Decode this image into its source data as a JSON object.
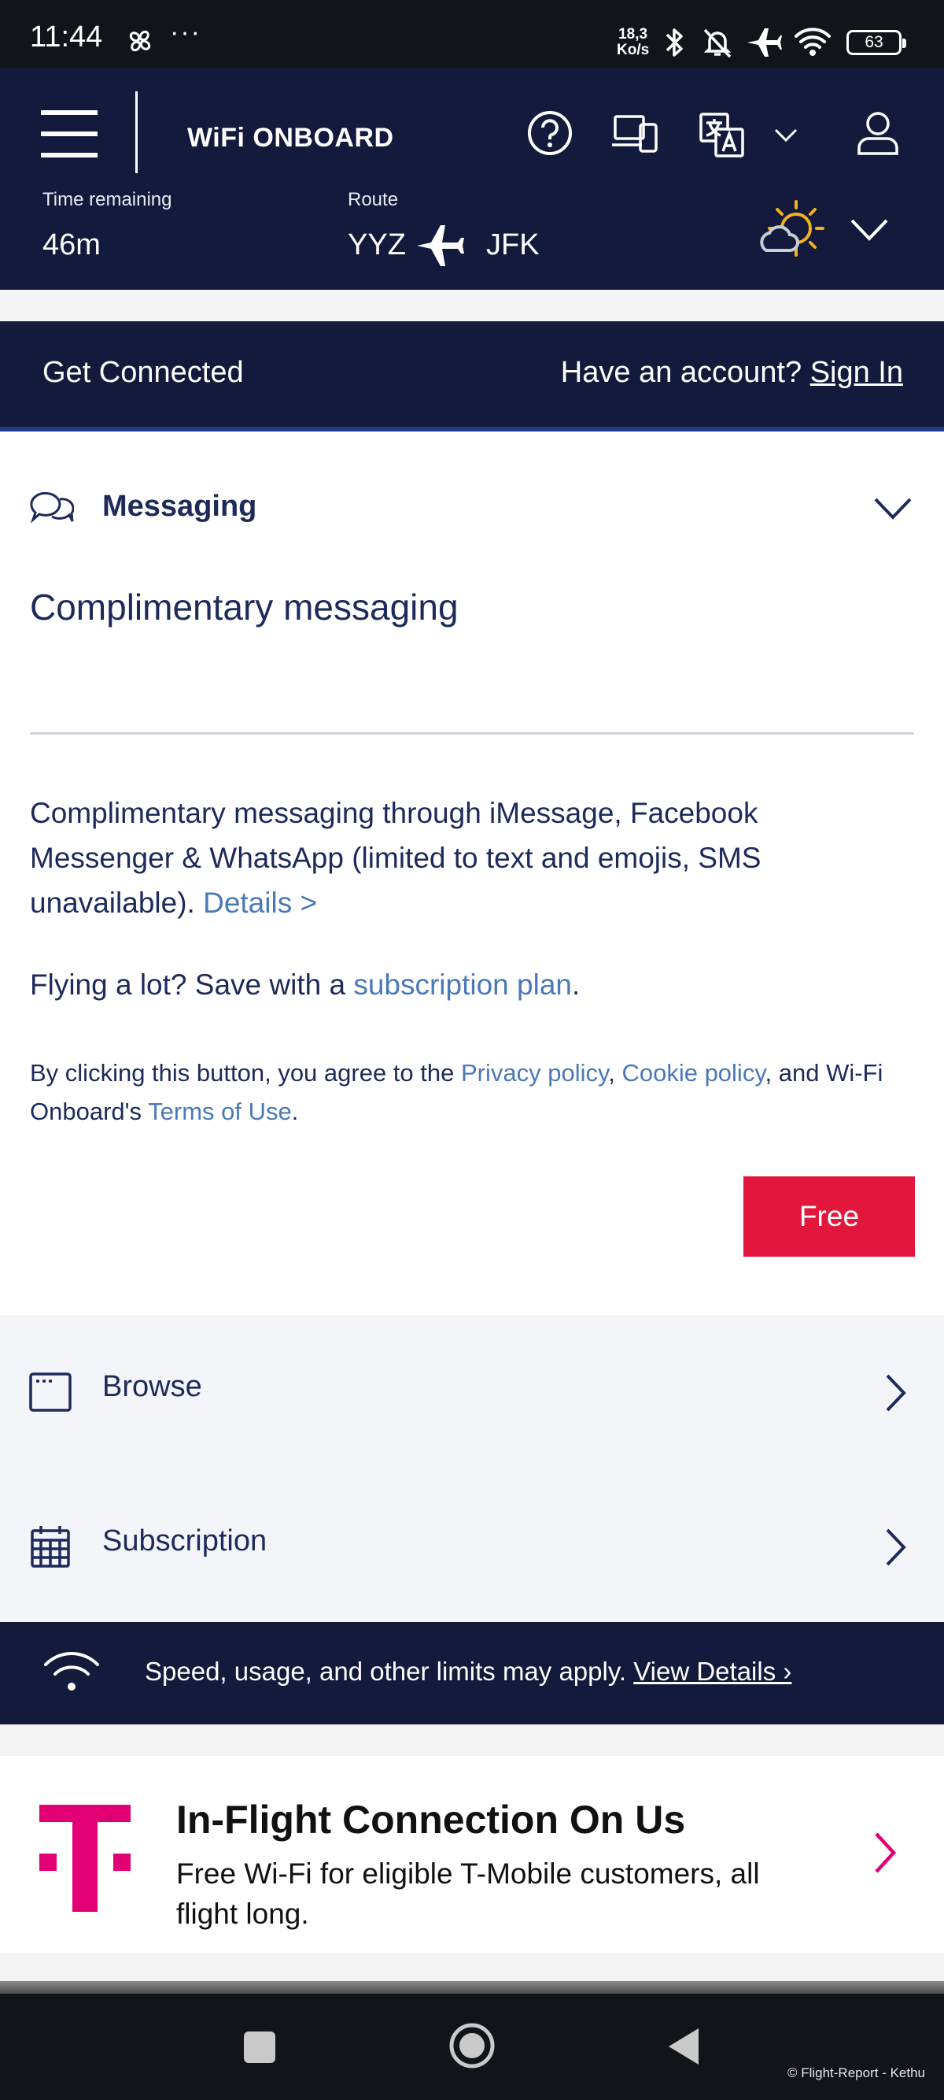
{
  "status_bar": {
    "time": "11:44",
    "extra": "···",
    "speed_value": "18,3",
    "speed_unit": "Ko/s",
    "battery": "63"
  },
  "header": {
    "brand": "WiFi ONBOARD",
    "time_remaining_label": "Time remaining",
    "time_remaining_value": "46m",
    "route_label": "Route",
    "route_from": "YYZ",
    "route_to": "JFK"
  },
  "connect_bar": {
    "title": "Get Connected",
    "account_prompt": "Have an account?",
    "sign_in": "Sign In"
  },
  "messaging": {
    "section_label": "Messaging",
    "subtitle": "Complimentary messaging",
    "description": "Complimentary messaging through iMessage, Facebook Messenger & WhatsApp (limited to text and emojis, SMS unavailable).",
    "details_link": "Details >",
    "flying_text": "Flying a lot? Save with a",
    "subscription_link": "subscription plan",
    "legal_prefix": "By clicking this button, you agree to the",
    "privacy_link": "Privacy policy",
    "cookie_link": "Cookie policy",
    "legal_middle": ", and Wi-Fi Onboard's",
    "terms_link": "Terms of Use",
    "free_button": "Free"
  },
  "options": [
    {
      "label": "Browse"
    },
    {
      "label": "Subscription"
    }
  ],
  "limits_banner": {
    "text": "Speed, usage, and other limits may apply.",
    "link": "View Details ›"
  },
  "promo": {
    "title": "In-Flight Connection On Us",
    "body": "Free Wi-Fi for eligible T-Mobile customers, all flight long."
  },
  "footer": {
    "credit": "© Flight-Report - Kethu"
  },
  "colors": {
    "navy": "#141a3c",
    "text_navy": "#1d2a5a",
    "link_blue": "#4b79b8",
    "free_red": "#e3173e",
    "tmobile_magenta": "#e20074",
    "sun_yellow": "#f2b21b"
  }
}
